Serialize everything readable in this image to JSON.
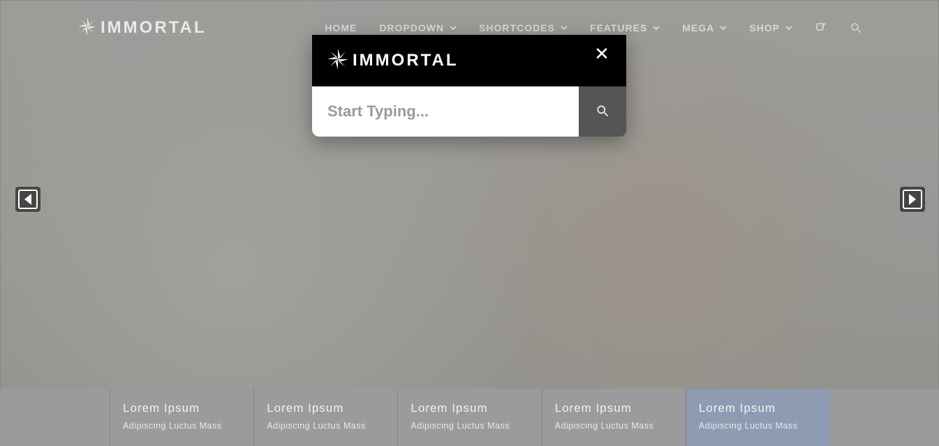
{
  "brand": {
    "name": "IMMORTAL"
  },
  "nav": {
    "items": [
      {
        "label": "HOME",
        "has_dropdown": false
      },
      {
        "label": "DROPDOWN",
        "has_dropdown": true
      },
      {
        "label": "SHORTCODES",
        "has_dropdown": true
      },
      {
        "label": "FEATURES",
        "has_dropdown": true
      },
      {
        "label": "MEGA",
        "has_dropdown": true
      },
      {
        "label": "SHOP",
        "has_dropdown": true
      }
    ],
    "icons": {
      "share": "share-icon",
      "search": "search-icon"
    }
  },
  "search_modal": {
    "logo_text": "IMMORTAL",
    "placeholder": "Start Typing...",
    "value": ""
  },
  "slider_tabs": [
    {
      "title": "Lorem Ipsum",
      "subtitle": "Adipiscing Luctus Mass",
      "active": false
    },
    {
      "title": "Lorem Ipsum",
      "subtitle": "Adipiscing Luctus Mass",
      "active": false
    },
    {
      "title": "Lorem Ipsum",
      "subtitle": "Adipiscing Luctus Mass",
      "active": false
    },
    {
      "title": "Lorem Ipsum",
      "subtitle": "Adipiscing Luctus Mass",
      "active": false
    },
    {
      "title": "Lorem Ipsum",
      "subtitle": "Adipiscing Luctus Mass",
      "active": true
    }
  ]
}
